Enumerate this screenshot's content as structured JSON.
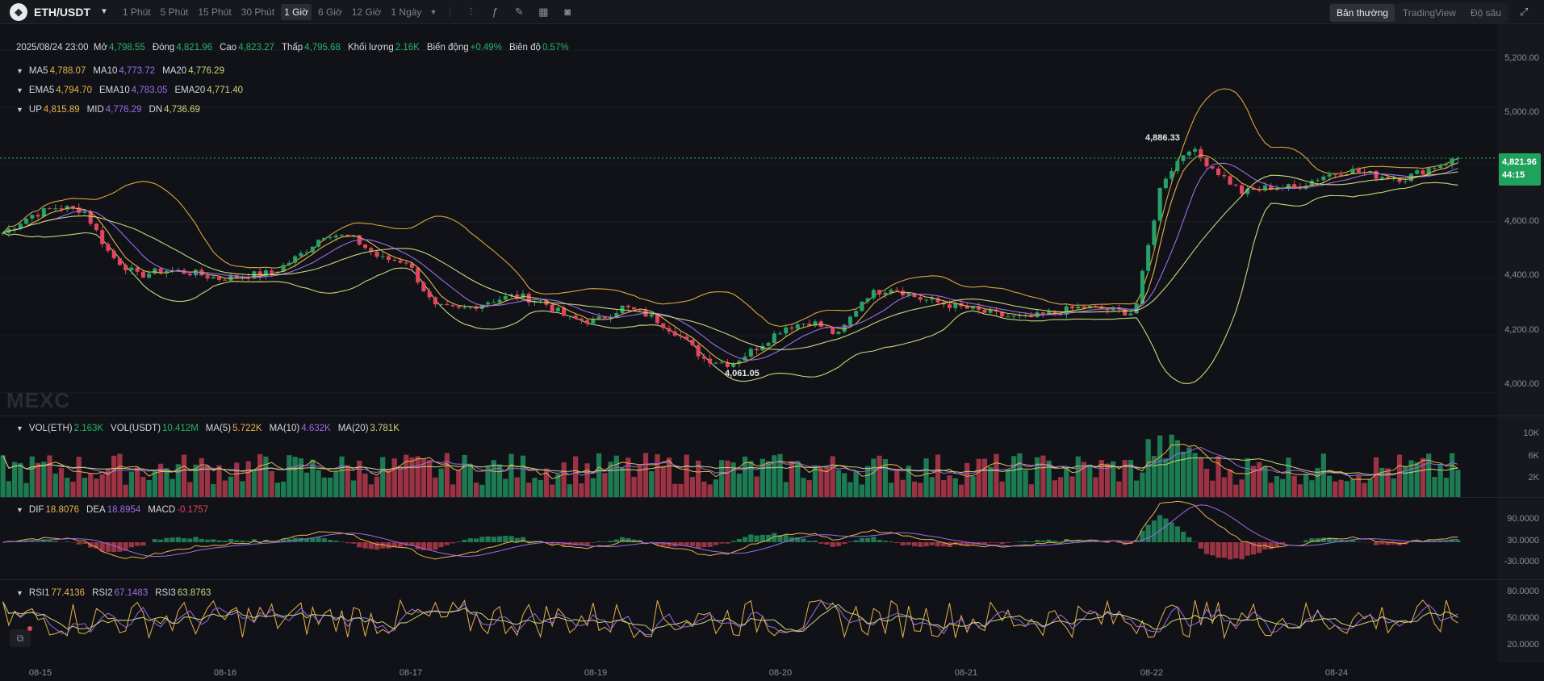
{
  "header": {
    "pair": "ETH/USDT",
    "timeframes": [
      "1 Phút",
      "5 Phút",
      "15 Phút",
      "30 Phút",
      "1 Giờ",
      "6 Giờ",
      "12 Giờ",
      "1 Ngày"
    ],
    "active_timeframe": "1 Giờ",
    "views": [
      "Bản thường",
      "TradingView",
      "Độ sâu"
    ],
    "active_view": "Bản thường"
  },
  "ohlc": {
    "date": "2025/08/24 23:00",
    "open_label": "Mở",
    "open": "4,798.55",
    "close_label": "Đóng",
    "close": "4,821.96",
    "high_label": "Cao",
    "high": "4,823.27",
    "low_label": "Thấp",
    "low": "4,795.68",
    "volume_label": "Khối lượng",
    "volume": "2.16K",
    "change_label": "Biến động",
    "change": "+0.49%",
    "amplitude_label": "Biên độ",
    "amplitude": "0.57%"
  },
  "ma": {
    "ma5_label": "MA5",
    "ma5": "4,788.07",
    "ma10_label": "MA10",
    "ma10": "4,773.72",
    "ma20_label": "MA20",
    "ma20": "4,776.29"
  },
  "ema": {
    "ema5_label": "EMA5",
    "ema5": "4,794.70",
    "ema10_label": "EMA10",
    "ema10": "4,783.05",
    "ema20_label": "EMA20",
    "ema20": "4,771.40"
  },
  "boll": {
    "up_label": "UP",
    "up": "4,815.89",
    "mid_label": "MID",
    "mid": "4,776.29",
    "dn_label": "DN",
    "dn": "4,736.69"
  },
  "price_axis": [
    "5,200.00",
    "5,000.00",
    "4,800.00",
    "4,600.00",
    "4,400.00",
    "4,200.00",
    "4,000.00"
  ],
  "last_price": "4,821.96",
  "countdown": "44:15",
  "high_marker": "4,886.33",
  "low_marker": "4,061.05",
  "watermark": "MEXC",
  "volume_panel": {
    "vol_eth_label": "VOL(ETH)",
    "vol_eth": "2.163K",
    "vol_usdt_label": "VOL(USDT)",
    "vol_usdt": "10.412M",
    "ma5_label": "MA(5)",
    "ma5": "5.722K",
    "ma10_label": "MA(10)",
    "ma10": "4.632K",
    "ma20_label": "MA(20)",
    "ma20": "3.781K",
    "axis": [
      "10K",
      "6K",
      "2K"
    ]
  },
  "macd_panel": {
    "dif_label": "DIF",
    "dif": "18.8076",
    "dea_label": "DEA",
    "dea": "18.8954",
    "macd_label": "MACD",
    "macd": "-0.1757",
    "axis": [
      "90.0000",
      "30.0000",
      "-30.0000"
    ]
  },
  "rsi_panel": {
    "rsi1_label": "RSI1",
    "rsi1": "77.4136",
    "rsi2_label": "RSI2",
    "rsi2": "67.1483",
    "rsi3_label": "RSI3",
    "rsi3": "63.8763",
    "axis": [
      "80.0000",
      "50.0000",
      "20.0000"
    ]
  },
  "time_axis": [
    "08-15",
    "08-16",
    "08-17",
    "08-19",
    "08-20",
    "08-21",
    "08-22",
    "08-24"
  ],
  "colors": {
    "up": "#26a269",
    "down": "#e2465e",
    "ma5": "#e8b24b",
    "ma10": "#9b6be8",
    "ma20": "#c7d67a",
    "boll": "#d9a53c"
  },
  "chart_data": {
    "type": "candlestick",
    "x_ticks": [
      "08-15",
      "08-16",
      "08-17",
      "08-19",
      "08-20",
      "08-21",
      "08-22",
      "08-24"
    ],
    "ylim": [
      3920,
      5260
    ],
    "close_path": [
      4560,
      4620,
      4650,
      4640,
      4480,
      4410,
      4430,
      4420,
      4400,
      4410,
      4420,
      4480,
      4560,
      4540,
      4470,
      4460,
      4300,
      4290,
      4320,
      4340,
      4320,
      4260,
      4250,
      4300,
      4270,
      4210,
      4120,
      4100,
      4160,
      4230,
      4250,
      4200,
      4340,
      4370,
      4330,
      4310,
      4290,
      4270,
      4260,
      4280,
      4300,
      4290,
      4280,
      4740,
      4860,
      4780,
      4700,
      4720,
      4720,
      4760,
      4780,
      4760,
      4750,
      4790,
      4820
    ],
    "low_point": 4061.05,
    "high_point": 4886.33,
    "last_close": 4821.96
  }
}
